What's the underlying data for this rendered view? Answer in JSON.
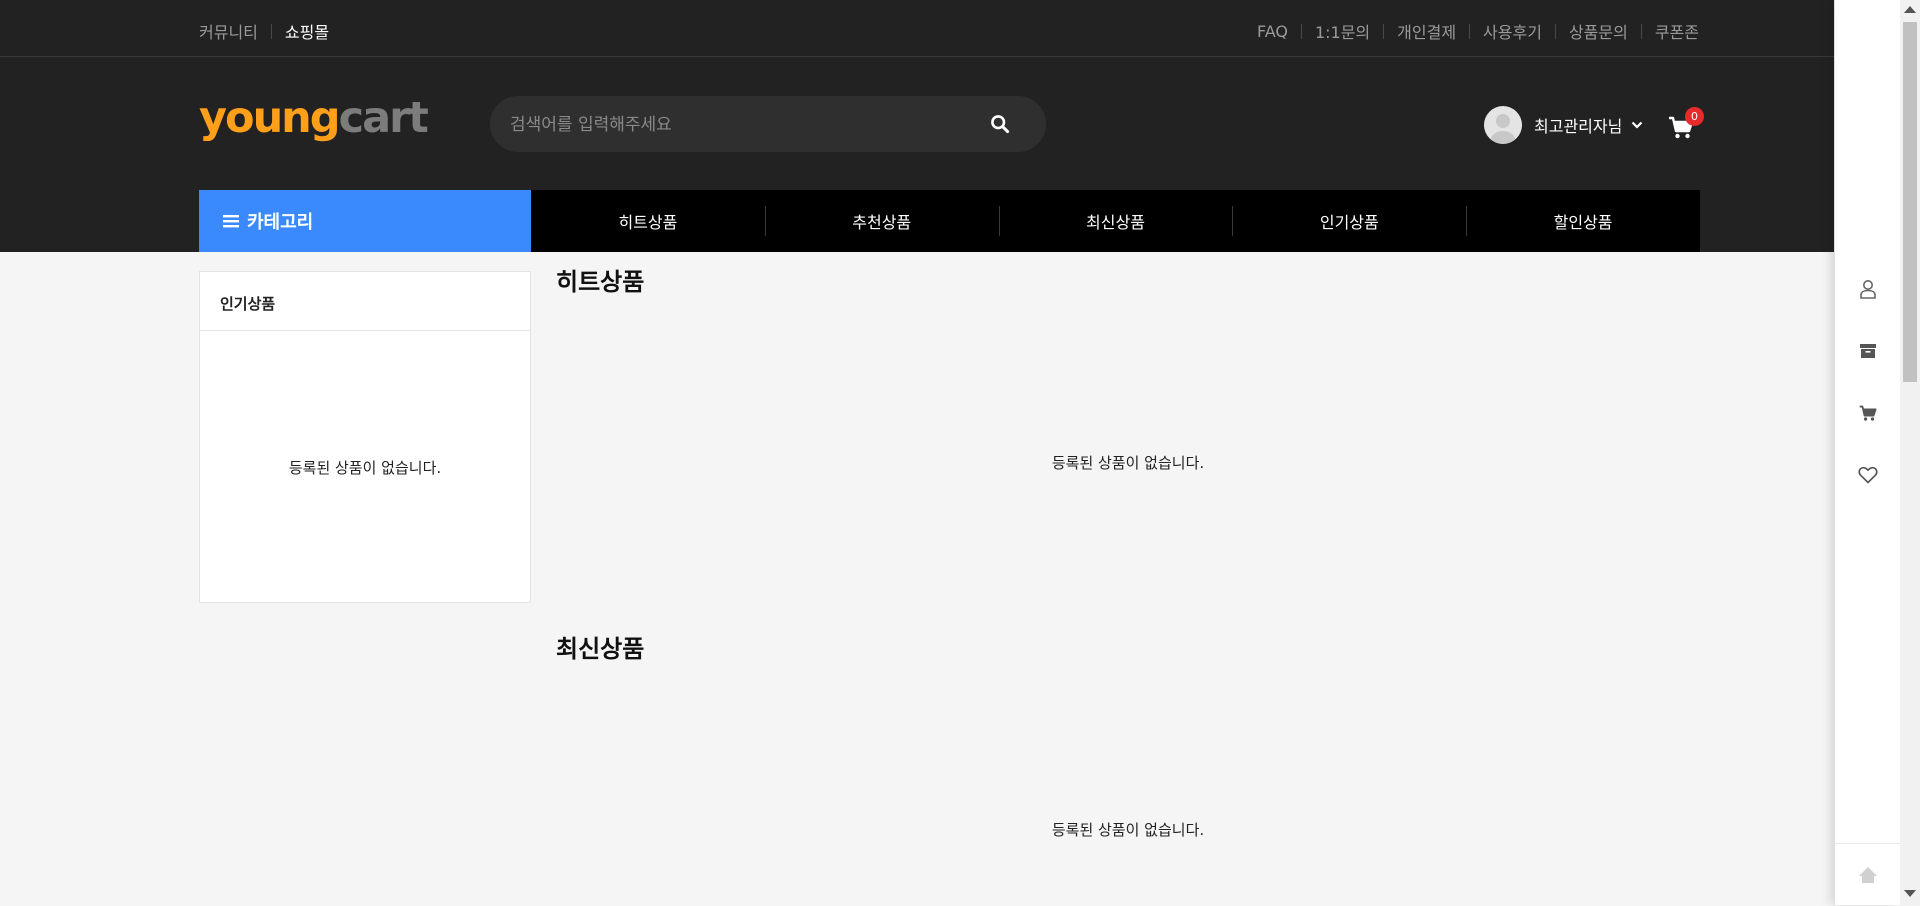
{
  "topbar": {
    "left_links": [
      {
        "label": "커뮤니티",
        "active": false
      },
      {
        "label": "쇼핑몰",
        "active": true
      }
    ],
    "right_links": [
      "FAQ",
      "1:1문의",
      "개인결제",
      "사용후기",
      "상품문의",
      "쿠폰존"
    ]
  },
  "logo": {
    "part1": "young",
    "part2": "cart"
  },
  "search": {
    "placeholder": "검색어를 입력해주세요",
    "icon": "search-icon"
  },
  "user": {
    "name": "최고관리자님",
    "icon": "avatar"
  },
  "cart": {
    "count": "0",
    "icon": "cart-icon"
  },
  "nav": {
    "category_label": "카테고리",
    "items": [
      "히트상품",
      "추천상품",
      "최신상품",
      "인기상품",
      "할인상품"
    ]
  },
  "sidebar": {
    "title": "인기상품",
    "empty_text": "등록된 상품이 없습니다."
  },
  "sections": [
    {
      "title": "히트상품",
      "empty_text": "등록된 상품이 없습니다."
    },
    {
      "title": "최신상품",
      "empty_text": "등록된 상품이 없습니다."
    }
  ],
  "right_rail": {
    "icons": [
      "user-icon",
      "archive-icon",
      "cart-icon",
      "heart-icon"
    ],
    "top_icon": "arrow-up-icon"
  },
  "colors": {
    "header_bg": "#222222",
    "category_button": "#3a8afd",
    "nav_bg": "#000000",
    "logo_accent": "#ff9f1a",
    "logo_gray": "#7c7c7c",
    "badge": "#e52b2b",
    "page_bg": "#f5f5f5"
  }
}
